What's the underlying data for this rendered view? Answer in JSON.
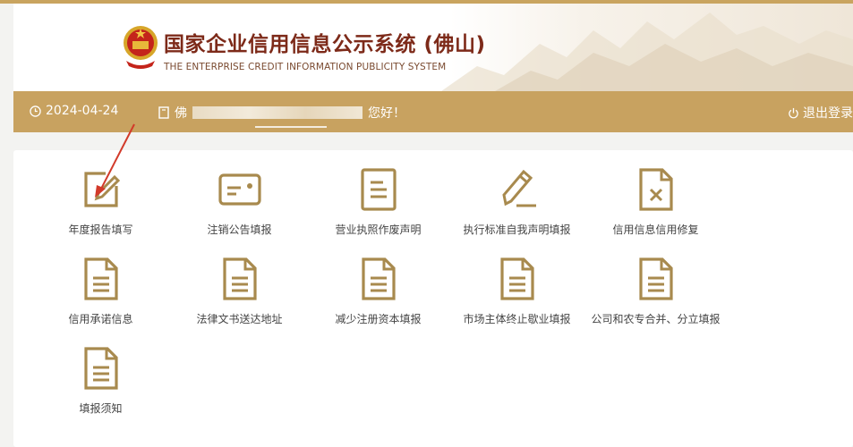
{
  "header": {
    "title": "国家企业信用信息公示系统 (佛山)",
    "subtitle": "THE ENTERPRISE CREDIT INFORMATION PUBLICITY SYSTEM"
  },
  "navbar": {
    "date": "2024-04-24",
    "user_prefix": "佛",
    "greeting": "您好！",
    "logout": "退出登录"
  },
  "tiles": [
    {
      "label": "年度报告填写",
      "icon": "edit-icon"
    },
    {
      "label": "注销公告填报",
      "icon": "card-icon"
    },
    {
      "label": "营业执照作废声明",
      "icon": "document-icon"
    },
    {
      "label": "执行标准自我声明填报",
      "icon": "pencil-icon"
    },
    {
      "label": "信用信息信用修复",
      "icon": "document-x-icon"
    },
    {
      "label": "信用承诺信息",
      "icon": "document-icon"
    },
    {
      "label": "法律文书送达地址",
      "icon": "document-icon"
    },
    {
      "label": "减少注册资本填报",
      "icon": "document-icon"
    },
    {
      "label": "市场主体终止歇业填报",
      "icon": "document-icon"
    },
    {
      "label": "公司和农专合并、分立填报",
      "icon": "document-icon"
    },
    {
      "label": "填报须知",
      "icon": "document-icon"
    }
  ],
  "colors": {
    "accent": "#c8a260",
    "icon": "#a88a4e",
    "title": "#7d2a19"
  }
}
